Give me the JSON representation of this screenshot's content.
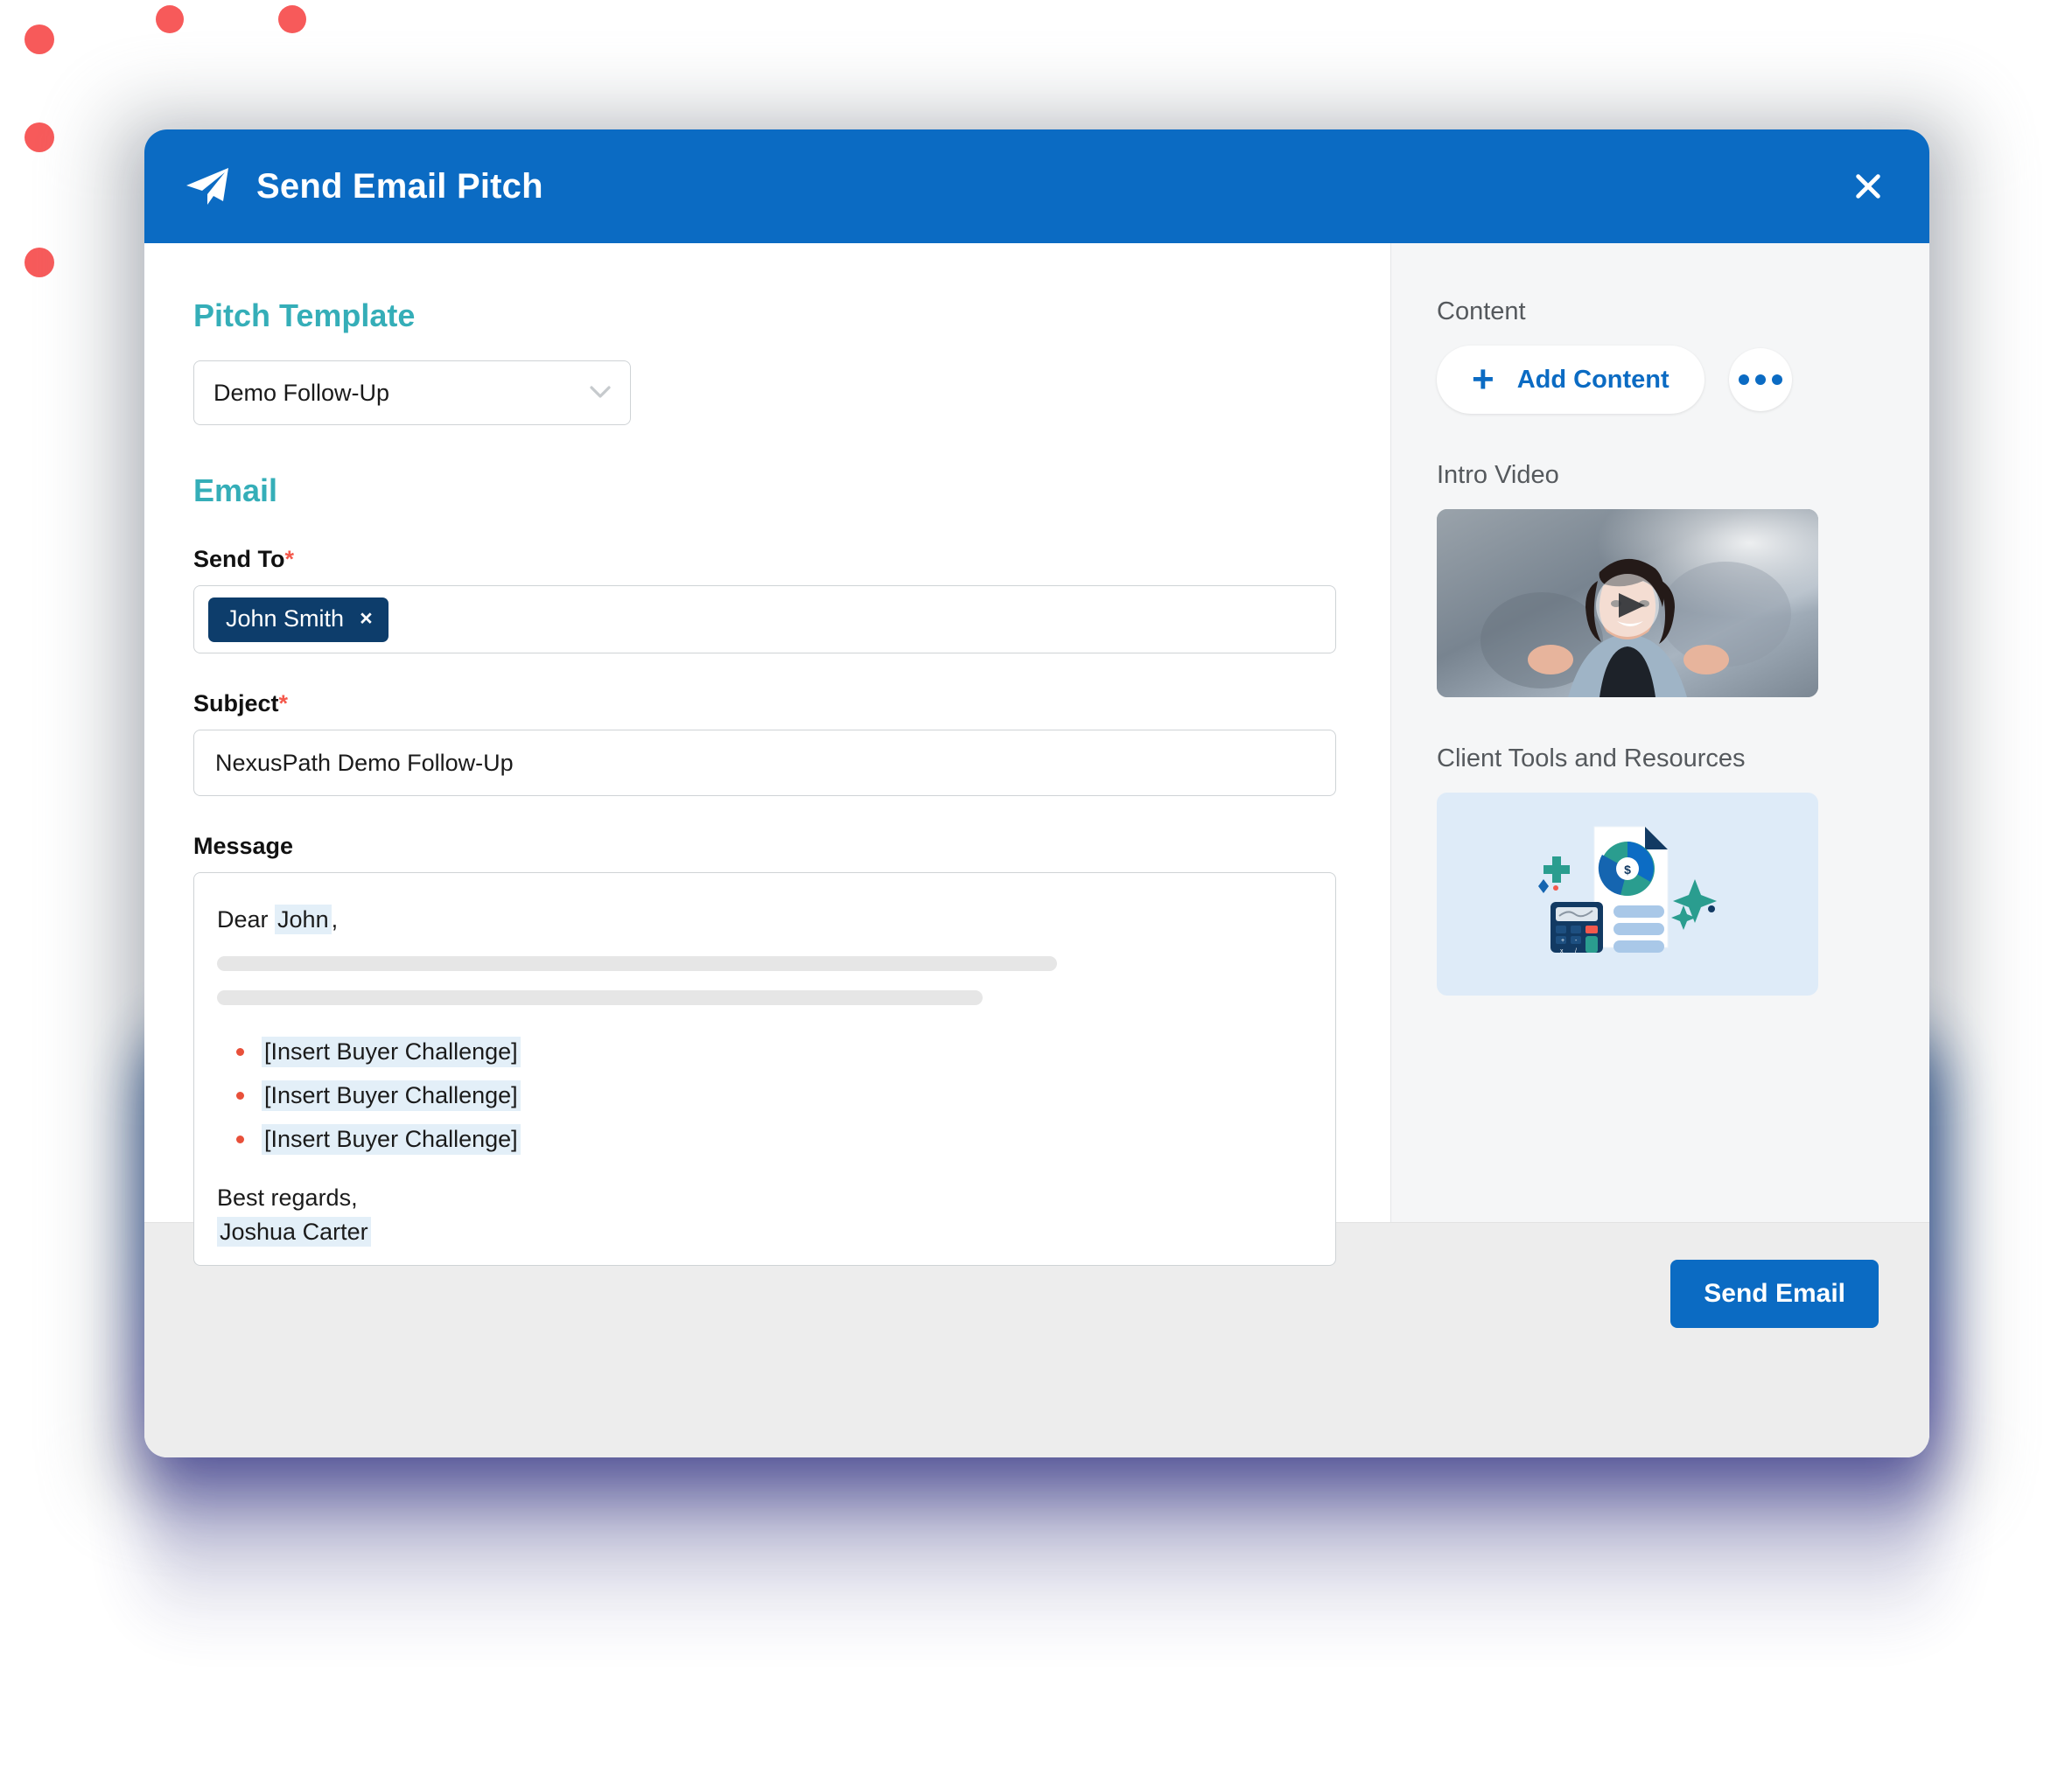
{
  "header": {
    "title": "Send Email Pitch",
    "plane_icon": "paper-plane-icon",
    "close_icon": "close-icon",
    "bg_color": "#0B6BC3"
  },
  "form": {
    "pitch_template_heading": "Pitch Template",
    "template_value": "Demo Follow-Up",
    "email_heading": "Email",
    "send_to_label": "Send To",
    "send_to_required": "*",
    "recipients": [
      {
        "name": "John Smith",
        "remove_icon": "×"
      }
    ],
    "subject_label": "Subject",
    "subject_required": "*",
    "subject_value": "NexusPath Demo Follow-Up",
    "message_label": "Message",
    "message": {
      "greeting_prefix": "Dear ",
      "greeting_name": "John",
      "greeting_suffix": ",",
      "bullets": [
        "[Insert Buyer Challenge]",
        "[Insert Buyer Challenge]",
        "[Insert Buyer Challenge]"
      ],
      "closing": "Best regards,",
      "signature": "Joshua Carter"
    }
  },
  "sidebar": {
    "content_label": "Content",
    "add_content_label": "Add Content",
    "add_icon": "plus-icon",
    "more_icon": "ellipsis-icon",
    "blocks": [
      {
        "label": "Intro Video",
        "type": "video-thumbnail",
        "play_icon": "play-icon"
      },
      {
        "label": "Client Tools and Resources",
        "type": "illustration-card"
      }
    ]
  },
  "footer": {
    "send_label": "Send Email"
  },
  "theme": {
    "accent_blue": "#0B6BC3",
    "teal_heading": "#35AEB8",
    "token_navy": "#0D3D6B",
    "required_red": "#F4594C",
    "highlight": "#E3EFF8",
    "dot_red": "#F75A5A"
  }
}
